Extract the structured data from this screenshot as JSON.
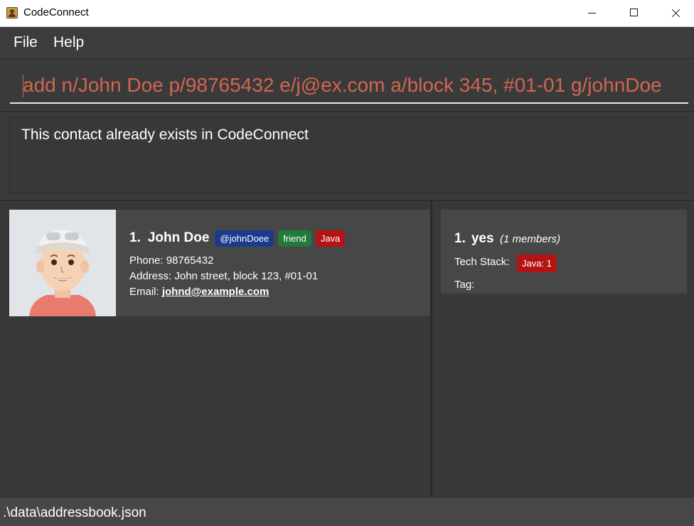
{
  "window": {
    "title": "CodeConnect"
  },
  "menu": {
    "items": [
      "File",
      "Help"
    ]
  },
  "command": {
    "value": "add n/John Doe p/98765432 e/j@ex.com a/block 345, #01-01 g/johnDoe"
  },
  "result": {
    "message": "This contact already exists in CodeConnect"
  },
  "persons": [
    {
      "index": "1.",
      "name": "John Doe",
      "handle": "@johnDoee",
      "tags": [
        "friend",
        "Java"
      ],
      "phone": "Phone: 98765432",
      "address": "Address: John street, block 123, #01-01",
      "email_label": "Email: ",
      "email": "johnd@example.com"
    }
  ],
  "groups": [
    {
      "index": "1.",
      "name": "yes",
      "members": "(1 members)",
      "techstack_label": "Tech Stack:",
      "techstack": [
        "Java: 1"
      ],
      "tag_label": "Tag:"
    }
  ],
  "status": {
    "path": ".\\data\\addressbook.json"
  },
  "colors": {
    "background": "#3a3a3a",
    "card": "#474747",
    "command_text": "#d06651",
    "handle_badge": "#1a3a8e",
    "friend_badge": "#1f7a3c",
    "java_badge": "#b31313"
  }
}
